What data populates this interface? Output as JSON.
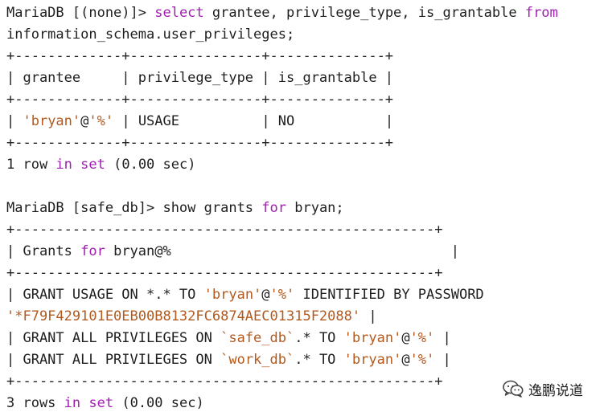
{
  "terminal": {
    "lines": [
      {
        "segments": [
          {
            "text": "MariaDB [(none)]> ",
            "style": "t"
          },
          {
            "text": "select",
            "style": "k"
          },
          {
            "text": " grantee, privilege_type, is_grantable ",
            "style": "t"
          },
          {
            "text": "from",
            "style": "k"
          }
        ]
      },
      {
        "segments": [
          {
            "text": "information_schema.user_privileges;",
            "style": "t"
          }
        ]
      },
      {
        "segments": [
          {
            "text": "+-------------+----------------+--------------+",
            "style": "t"
          }
        ]
      },
      {
        "segments": [
          {
            "text": "| grantee     | privilege_type | is_grantable |",
            "style": "t"
          }
        ]
      },
      {
        "segments": [
          {
            "text": "+-------------+----------------+--------------+",
            "style": "t"
          }
        ]
      },
      {
        "segments": [
          {
            "text": "| ",
            "style": "t"
          },
          {
            "text": "'bryan'",
            "style": "s"
          },
          {
            "text": "@",
            "style": "t"
          },
          {
            "text": "'%'",
            "style": "s"
          },
          {
            "text": " | USAGE          | NO           |",
            "style": "t"
          }
        ]
      },
      {
        "segments": [
          {
            "text": "+-------------+----------------+--------------+",
            "style": "t"
          }
        ]
      },
      {
        "segments": [
          {
            "text": "1 row ",
            "style": "t"
          },
          {
            "text": "in",
            "style": "k"
          },
          {
            "text": " ",
            "style": "t"
          },
          {
            "text": "set",
            "style": "k"
          },
          {
            "text": " (0.00 sec)",
            "style": "t"
          }
        ]
      },
      {
        "segments": [
          {
            "text": "",
            "style": "t"
          }
        ]
      },
      {
        "segments": [
          {
            "text": "MariaDB [safe_db]> show grants ",
            "style": "t"
          },
          {
            "text": "for",
            "style": "k"
          },
          {
            "text": " bryan;",
            "style": "t"
          }
        ]
      },
      {
        "segments": [
          {
            "text": "+---------------------------------------------------+",
            "style": "t"
          }
        ]
      },
      {
        "segments": [
          {
            "text": "| Grants ",
            "style": "t"
          },
          {
            "text": "for",
            "style": "k"
          },
          {
            "text": " bryan@%                                  |",
            "style": "t"
          }
        ]
      },
      {
        "segments": [
          {
            "text": "+---------------------------------------------------+",
            "style": "t"
          }
        ]
      },
      {
        "segments": [
          {
            "text": "| GRANT USAGE ON *.* TO ",
            "style": "t"
          },
          {
            "text": "'bryan'",
            "style": "s"
          },
          {
            "text": "@",
            "style": "t"
          },
          {
            "text": "'%'",
            "style": "s"
          },
          {
            "text": " IDENTIFIED BY PASSWORD",
            "style": "t"
          }
        ]
      },
      {
        "segments": [
          {
            "text": "'*F79F429101E0EB00B8132FC6874AEC01315F2088'",
            "style": "s"
          },
          {
            "text": " |",
            "style": "t"
          }
        ]
      },
      {
        "segments": [
          {
            "text": "| GRANT ALL PRIVILEGES ON ",
            "style": "t"
          },
          {
            "text": "`safe_db`",
            "style": "s"
          },
          {
            "text": ".* TO ",
            "style": "t"
          },
          {
            "text": "'bryan'",
            "style": "s"
          },
          {
            "text": "@",
            "style": "t"
          },
          {
            "text": "'%'",
            "style": "s"
          },
          {
            "text": " |",
            "style": "t"
          }
        ]
      },
      {
        "segments": [
          {
            "text": "| GRANT ALL PRIVILEGES ON ",
            "style": "t"
          },
          {
            "text": "`work_db`",
            "style": "s"
          },
          {
            "text": ".* TO ",
            "style": "t"
          },
          {
            "text": "'bryan'",
            "style": "s"
          },
          {
            "text": "@",
            "style": "t"
          },
          {
            "text": "'%'",
            "style": "s"
          },
          {
            "text": " |",
            "style": "t"
          }
        ]
      },
      {
        "segments": [
          {
            "text": "+---------------------------------------------------+",
            "style": "t"
          }
        ]
      },
      {
        "segments": [
          {
            "text": "3 rows ",
            "style": "t"
          },
          {
            "text": "in",
            "style": "k"
          },
          {
            "text": " ",
            "style": "t"
          },
          {
            "text": "set",
            "style": "k"
          },
          {
            "text": " (0.00 sec)",
            "style": "t"
          }
        ]
      }
    ]
  },
  "watermark": {
    "text": "逸鹏说道",
    "icon": "wechat-icon"
  },
  "colors": {
    "background": "#ffffff",
    "text": "#1f1f1f",
    "keyword": "#a020b0",
    "string": "#b35a1f"
  }
}
